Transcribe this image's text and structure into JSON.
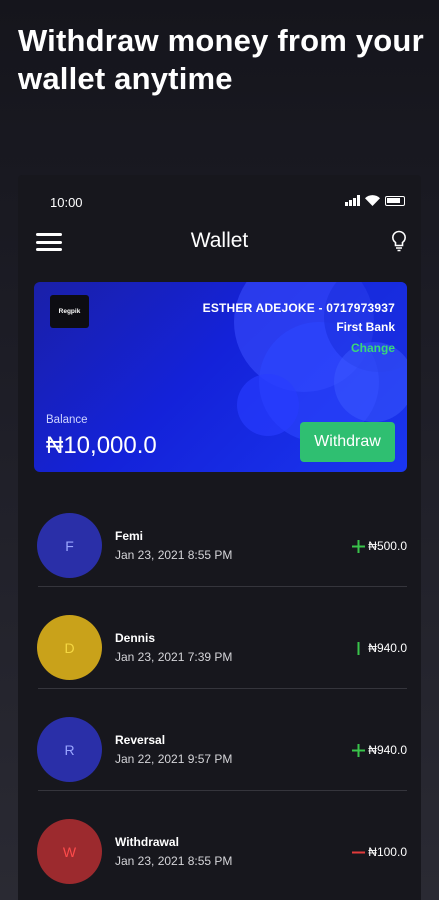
{
  "headline": "Withdraw money from your wallet anytime",
  "status_bar": {
    "time": "10:00"
  },
  "header": {
    "title": "Wallet",
    "menu_icon": "hamburger-menu-icon",
    "right_icon": "lightbulb-icon"
  },
  "card": {
    "logo_text": "Regpik",
    "account": "ESTHER ADEJOKE  - 0717973937",
    "bank": "First Bank",
    "change_label": "Change",
    "balance_label": "Balance",
    "balance_value": "₦10,000.0",
    "withdraw_label": "Withdraw"
  },
  "transactions": [
    {
      "initial": "F",
      "name": "Femi",
      "date": "Jan 23, 2021 8:55 PM",
      "amount": "₦500.0",
      "indicator": "plus-icon",
      "indicator_color": "#39c44a",
      "avatar_bg": "#2a2fa8",
      "initial_color": "#9aa6ff"
    },
    {
      "initial": "D",
      "name": "Dennis",
      "date": "Jan 23, 2021 7:39 PM",
      "amount": "₦940.0",
      "indicator": "bar-icon",
      "indicator_color": "#39c44a",
      "avatar_bg": "#c9a21a",
      "initial_color": "#f5d742"
    },
    {
      "initial": "R",
      "name": "Reversal",
      "date": "Jan 22, 2021 9:57 PM",
      "amount": "₦940.0",
      "indicator": "plus-icon",
      "indicator_color": "#39c44a",
      "avatar_bg": "#2a2fa8",
      "initial_color": "#9aa6ff"
    },
    {
      "initial": "W",
      "name": "Withdrawal",
      "date": "Jan 23, 2021 8:55 PM",
      "amount": "₦100.0",
      "indicator": "minus-icon",
      "indicator_color": "#e23b3b",
      "avatar_bg": "#9c2a2e",
      "initial_color": "#ff4b4b"
    }
  ],
  "colors": {
    "accent_green": "#2fbf71",
    "change_green": "#39d77a",
    "card_blue": "#1422d9"
  }
}
